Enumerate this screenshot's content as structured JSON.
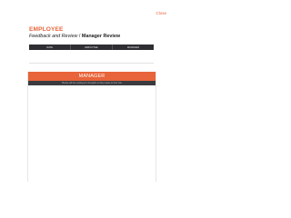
{
  "header": {
    "close_label": "Close",
    "title": "EMPLOYEE",
    "breadcrumb": "Feedback and Review",
    "separator": " / ",
    "current": "Manager Review"
  },
  "review_table": {
    "columns": [
      "DATE",
      "EMPLOYEE",
      "MANAGER"
    ]
  },
  "manager_panel": {
    "title": "MANAGER",
    "instruction": "Please tell the employee's strengths so they relate to their role"
  },
  "colors": {
    "accent": "#e8643a",
    "dark_bar": "#2e2e33"
  }
}
